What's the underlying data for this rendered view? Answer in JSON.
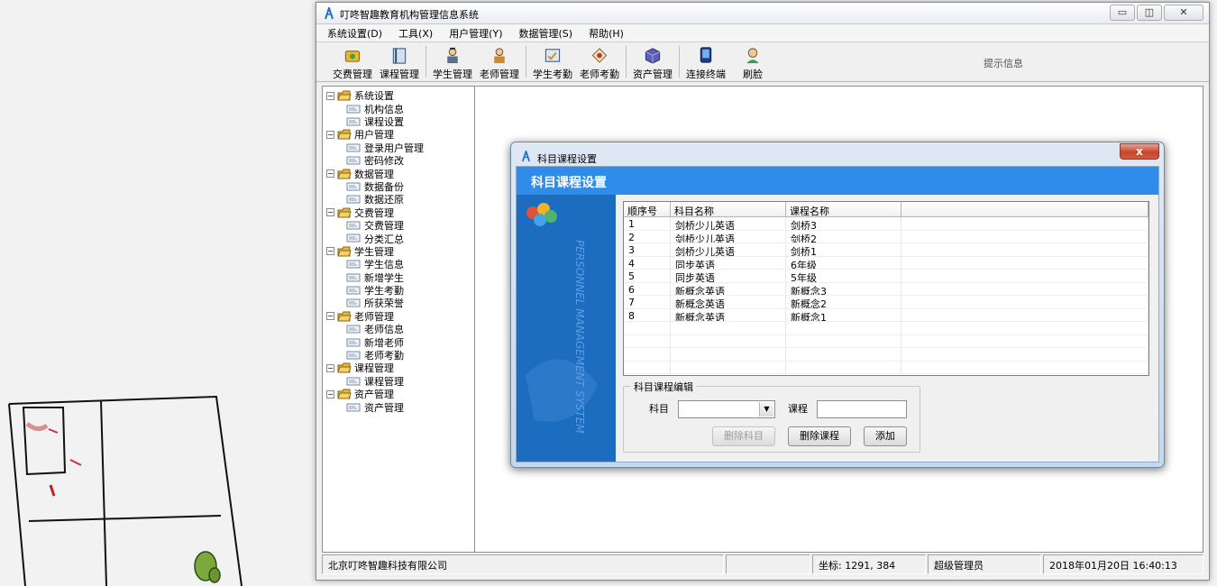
{
  "window": {
    "title": "叮咚智趣教育机构管理信息系统"
  },
  "menu": [
    "系统设置(D)",
    "工具(X)",
    "用户管理(Y)",
    "数据管理(S)",
    "帮助(H)"
  ],
  "toolbar": {
    "buttons": [
      {
        "label": "交费管理",
        "icon": "payment-icon"
      },
      {
        "label": "课程管理",
        "icon": "course-book-icon"
      },
      {
        "label": "学生管理",
        "icon": "student-icon"
      },
      {
        "label": "老师管理",
        "icon": "teacher-icon"
      },
      {
        "label": "学生考勤",
        "icon": "student-attendance-icon"
      },
      {
        "label": "老师考勤",
        "icon": "teacher-attendance-icon"
      },
      {
        "label": "资产管理",
        "icon": "asset-cube-icon"
      },
      {
        "label": "连接终端",
        "icon": "terminal-icon"
      },
      {
        "label": "刷脸",
        "icon": "face-scan-icon"
      }
    ],
    "tip": "提示信息"
  },
  "tree": [
    {
      "label": "系统设置",
      "children": [
        "机构信息",
        "课程设置"
      ]
    },
    {
      "label": "用户管理",
      "children": [
        "登录用户管理",
        "密码修改"
      ]
    },
    {
      "label": "数据管理",
      "children": [
        "数据备份",
        "数据还原"
      ]
    },
    {
      "label": "交费管理",
      "children": [
        "交费管理",
        "分类汇总"
      ]
    },
    {
      "label": "学生管理",
      "children": [
        "学生信息",
        "新增学生",
        "学生考勤",
        "所获荣誉"
      ]
    },
    {
      "label": "老师管理",
      "children": [
        "老师信息",
        "新增老师",
        "老师考勤"
      ]
    },
    {
      "label": "课程管理",
      "children": [
        "课程管理"
      ]
    },
    {
      "label": "资产管理",
      "children": [
        "资产管理"
      ]
    }
  ],
  "status": {
    "company": "北京叮咚智趣科技有限公司",
    "coords": "坐标: 1291, 384",
    "user": "超级管理员",
    "datetime": "2018年01月20日  16:40:13"
  },
  "dialog": {
    "title": "科目课程设置",
    "header": "科目课程设置",
    "side_text": "PERSONNEL MANAGEMENT SYSTEM",
    "close": "x",
    "table": {
      "columns": [
        "顺序号",
        "科目名称",
        "课程名称"
      ],
      "rows": [
        [
          "1",
          "剑桥少儿英语",
          "剑桥3"
        ],
        [
          "2",
          "剑桥少儿英语",
          "剑桥2"
        ],
        [
          "3",
          "剑桥少儿英语",
          "剑桥1"
        ],
        [
          "4",
          "同步英语",
          "6年级"
        ],
        [
          "5",
          "同步英语",
          "5年级"
        ],
        [
          "6",
          "新概念英语",
          "新概念3"
        ],
        [
          "7",
          "新概念英语",
          "新概念2"
        ],
        [
          "8",
          "新概念英语",
          "新概念1"
        ]
      ]
    },
    "edit": {
      "group_title": "科目课程编辑",
      "subject_label": "科目",
      "subject_value": "",
      "course_label": "课程",
      "course_value": "",
      "delete_subject": "删除科目",
      "delete_course": "删除课程",
      "add": "添加"
    }
  }
}
